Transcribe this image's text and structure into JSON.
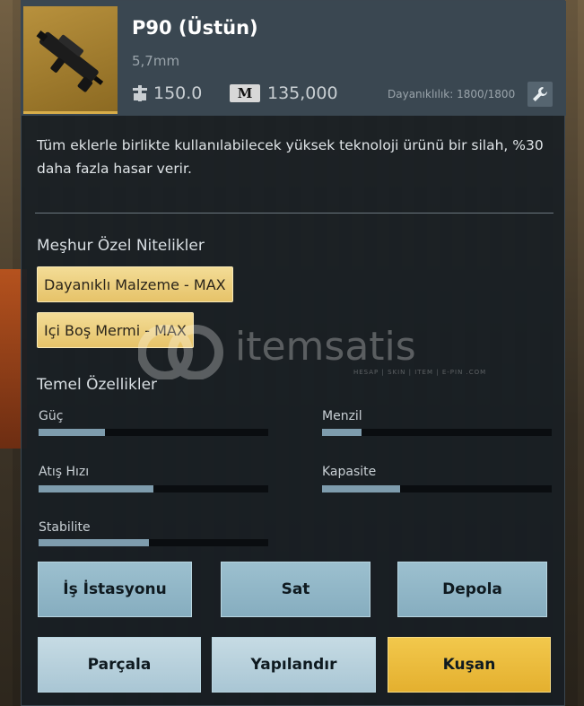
{
  "item": {
    "name": "P90 (Üstün)",
    "caliber": "5,7mm",
    "weight": "150.0",
    "price": "135,000",
    "currency_icon_text": "M",
    "durability": "Dayanıklılık: 1800/1800",
    "description": "Tüm eklerle birlikte kullanılabilecek yüksek teknoloji ürünü bir silah, %30 daha fazla hasar verir.",
    "icons": {
      "weapon": "smg-icon",
      "weight": "weight-icon",
      "currency": "coin-icon",
      "repair": "wrench-icon"
    }
  },
  "perks": {
    "title": "Meşhur Özel Nitelikler",
    "items": [
      "Dayanıklı Malzeme - MAX",
      "Içi Boş Mermi - MAX"
    ]
  },
  "stats": {
    "title": "Temel Özellikler",
    "items": [
      {
        "label": "Güç",
        "value": 0.29
      },
      {
        "label": "Menzil",
        "value": 0.17
      },
      {
        "label": "Atış Hızı",
        "value": 0.5
      },
      {
        "label": "Kapasite",
        "value": 0.34
      },
      {
        "label": "Stabilite",
        "value": 0.48
      }
    ]
  },
  "actions": {
    "workstation": "İş İstasyonu",
    "sell": "Sat",
    "store": "Depola",
    "dismantle": "Parçala",
    "configure": "Yapılandır",
    "equip": "Kuşan"
  },
  "watermark": {
    "text": "itemsatis",
    "sub": "HESAP | SKIN | ITEM | E-PIN .COM"
  },
  "colors": {
    "accent_gold": "#e4b02f",
    "button_blue": "#86adbf",
    "bar_fill": "#7e9cad",
    "panel_bg": "#181e24"
  }
}
